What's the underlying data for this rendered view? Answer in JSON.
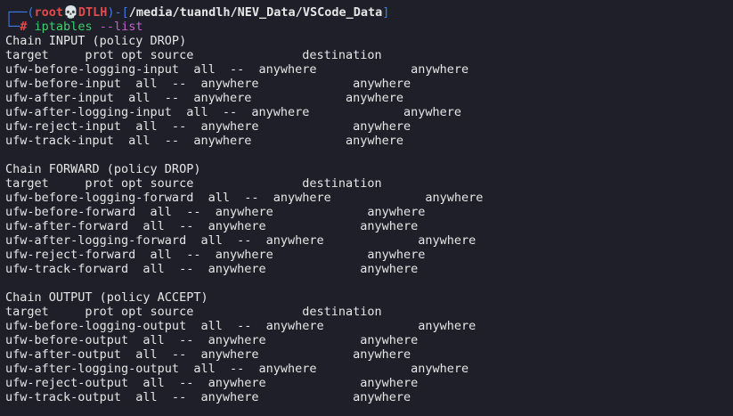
{
  "prompt": {
    "frame_open": "┌──(",
    "user": "root",
    "skull": "💀",
    "host": "DTLH",
    "frame_mid": ")-[",
    "path": "/media/tuandlh/NEV_Data/VSCode_Data",
    "frame_close": "]",
    "frame_lower": "└─",
    "hash": "#",
    "command": "iptables",
    "argument": "--list"
  },
  "output_lines": [
    "Chain INPUT (policy DROP)",
    "target     prot opt source               destination",
    "ufw-before-logging-input  all  --  anywhere             anywhere",
    "ufw-before-input  all  --  anywhere             anywhere",
    "ufw-after-input  all  --  anywhere             anywhere",
    "ufw-after-logging-input  all  --  anywhere             anywhere",
    "ufw-reject-input  all  --  anywhere             anywhere",
    "ufw-track-input  all  --  anywhere             anywhere",
    "",
    "Chain FORWARD (policy DROP)",
    "target     prot opt source               destination",
    "ufw-before-logging-forward  all  --  anywhere             anywhere",
    "ufw-before-forward  all  --  anywhere             anywhere",
    "ufw-after-forward  all  --  anywhere             anywhere",
    "ufw-after-logging-forward  all  --  anywhere             anywhere",
    "ufw-reject-forward  all  --  anywhere             anywhere",
    "ufw-track-forward  all  --  anywhere             anywhere",
    "",
    "Chain OUTPUT (policy ACCEPT)",
    "target     prot opt source               destination",
    "ufw-before-logging-output  all  --  anywhere             anywhere",
    "ufw-before-output  all  --  anywhere             anywhere",
    "ufw-after-output  all  --  anywhere             anywhere",
    "ufw-after-logging-output  all  --  anywhere             anywhere",
    "ufw-reject-output  all  --  anywhere             anywhere",
    "ufw-track-output  all  --  anywhere             anywhere"
  ],
  "colors": {
    "background": "#1e1f29",
    "frame": "#3b7ce8",
    "user": "#e24b4b",
    "command": "#3fcf6a",
    "argument": "#c85fd1",
    "text": "#e6e6e6"
  }
}
